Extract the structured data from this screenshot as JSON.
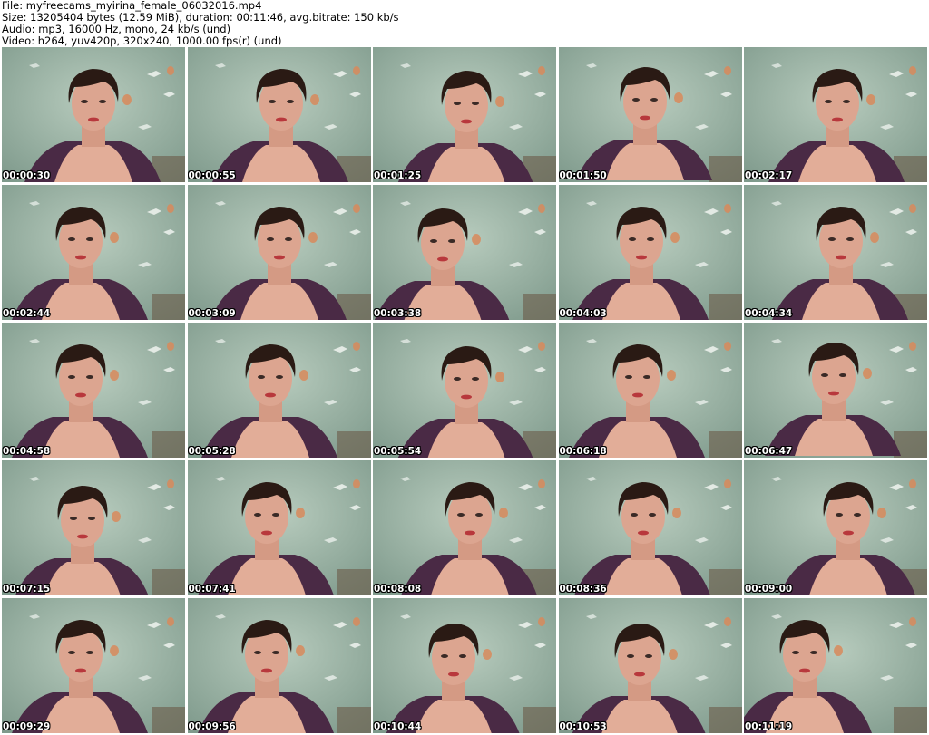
{
  "header": {
    "file_line": "File: myfreecams_myirina_female_06032016.mp4",
    "size_line": "Size: 13205404 bytes (12.59 MiB), duration: 00:11:46, avg.bitrate: 150 kb/s",
    "audio_line": "Audio: mp3, 16000 Hz, mono, 24 kb/s (und)",
    "video_line": "Video: h264, yuv420p, 320x240, 1000.00 fps(r) (und)"
  },
  "thumbnails": [
    {
      "timestamp": "00:00:30"
    },
    {
      "timestamp": "00:00:55"
    },
    {
      "timestamp": "00:01:25"
    },
    {
      "timestamp": "00:01:50"
    },
    {
      "timestamp": "00:02:17"
    },
    {
      "timestamp": "00:02:44"
    },
    {
      "timestamp": "00:03:09"
    },
    {
      "timestamp": "00:03:38"
    },
    {
      "timestamp": "00:04:03"
    },
    {
      "timestamp": "00:04:34"
    },
    {
      "timestamp": "00:04:58"
    },
    {
      "timestamp": "00:05:28"
    },
    {
      "timestamp": "00:05:54"
    },
    {
      "timestamp": "00:06:18"
    },
    {
      "timestamp": "00:06:47"
    },
    {
      "timestamp": "00:07:15"
    },
    {
      "timestamp": "00:07:41"
    },
    {
      "timestamp": "00:08:08"
    },
    {
      "timestamp": "00:08:36"
    },
    {
      "timestamp": "00:09:00"
    },
    {
      "timestamp": "00:09:29"
    },
    {
      "timestamp": "00:09:56"
    },
    {
      "timestamp": "00:10:44"
    },
    {
      "timestamp": "00:10:53"
    },
    {
      "timestamp": "00:11:19"
    }
  ],
  "colors": {
    "background": "#ffffff",
    "wallpaper": "#98b2a4",
    "hair": "#2a1a14",
    "skin": "#d9a08a",
    "top": "#4a2a45",
    "timestamp_text": "#ffffff"
  }
}
